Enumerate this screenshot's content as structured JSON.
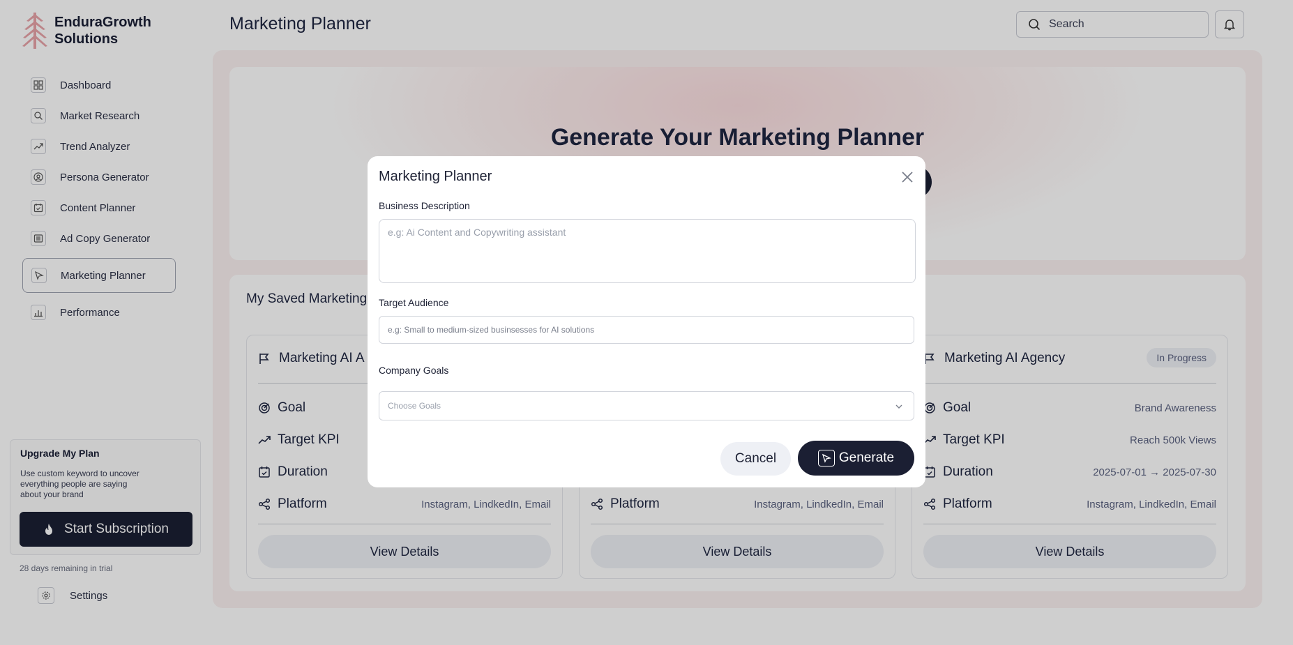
{
  "brand": {
    "name": "EnduraGrowth Solutions",
    "logo_icon": "tree-logo-icon",
    "logo_color": "#e8a3a8"
  },
  "sidebar": {
    "items": [
      {
        "label": "Dashboard",
        "icon": "grid-icon"
      },
      {
        "label": "Market Research",
        "icon": "search-icon"
      },
      {
        "label": "Trend Analyzer",
        "icon": "trend-icon"
      },
      {
        "label": "Persona Generator",
        "icon": "user-circle-icon"
      },
      {
        "label": "Content Planner",
        "icon": "calendar-check-icon"
      },
      {
        "label": "Ad Copy Generator",
        "icon": "document-icon"
      },
      {
        "label": "Marketing Planner",
        "icon": "pointer-icon",
        "active": true
      },
      {
        "label": "Performance",
        "icon": "bar-chart-icon"
      }
    ],
    "upgrade": {
      "title": "Upgrade My Plan",
      "text": "Use custom keyword to uncover everything people are saying about your brand",
      "button": "Start Subscription"
    },
    "trial": "28 days remaining in trial",
    "settings": "Settings"
  },
  "header": {
    "title": "Marketing Planner",
    "search_placeholder": "Search"
  },
  "hero": {
    "title": "Generate Your Marketing Planner"
  },
  "saved": {
    "title": "My Saved Marketing",
    "cards": [
      {
        "title": "Marketing AI A",
        "badge": "",
        "rows": [
          {
            "k": "Goal",
            "v": ""
          },
          {
            "k": "Target KPI",
            "v": ""
          },
          {
            "k": "Duration",
            "v": ""
          },
          {
            "k": "Platform",
            "v": "Instagram, LindkedIn, Email"
          }
        ],
        "button": "View Details"
      },
      {
        "title": "",
        "badge": "",
        "rows": [
          {
            "k": "",
            "v": ""
          },
          {
            "k": "",
            "v": ""
          },
          {
            "k": "",
            "v": ""
          },
          {
            "k": "Platform",
            "v": "Instagram, LindkedIn, Email"
          }
        ],
        "button": "View Details"
      },
      {
        "title": "Marketing AI Agency",
        "badge": "In Progress",
        "rows": [
          {
            "k": "Goal",
            "v": "Brand Awareness"
          },
          {
            "k": "Target KPI",
            "v": "Reach 500k Views"
          },
          {
            "k": "Duration",
            "v": "2025-07-01 → 2025-07-30"
          },
          {
            "k": "Platform",
            "v": "Instagram, LindkedIn, Email"
          }
        ],
        "button": "View Details"
      }
    ]
  },
  "modal": {
    "title": "Marketing Planner",
    "business_label": "Business Description",
    "business_placeholder": "e.g: Ai Content and Copywriting assistant",
    "audience_label": "Target Audience",
    "audience_placeholder": "e.g: Small to medium-sized businsesses for AI solutions",
    "goals_label": "Company Goals",
    "goals_placeholder": "Choose Goals",
    "cancel": "Cancel",
    "generate": "Generate"
  },
  "colors": {
    "accent": "#1b1f33",
    "hero_tint": "#fbdddf",
    "page_tint": "#fbf1f0"
  }
}
